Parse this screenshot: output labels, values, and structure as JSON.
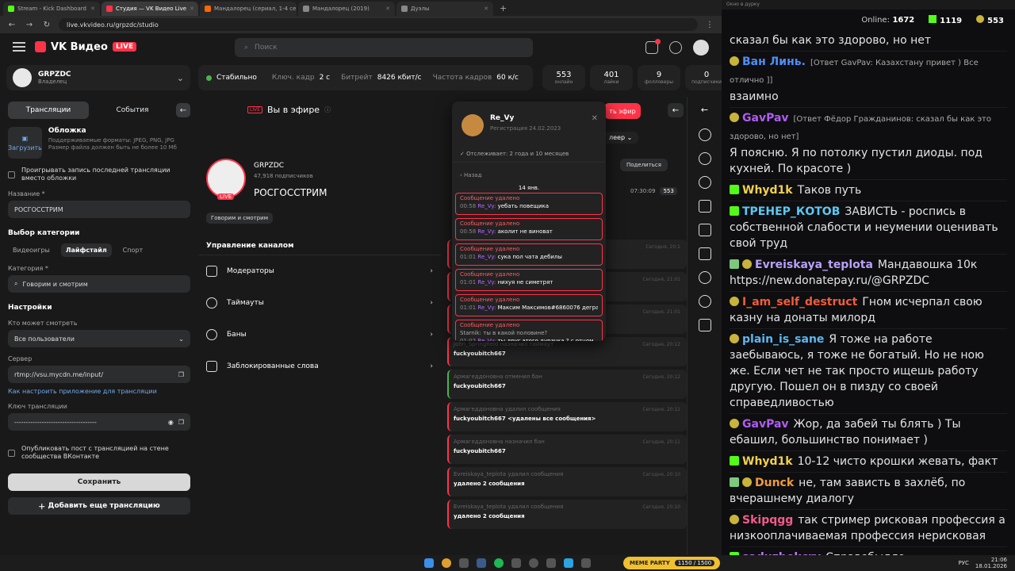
{
  "browser": {
    "tabs": [
      {
        "label": "Stream - Kick Dashboard",
        "color": "#53fc18"
      },
      {
        "label": "Студия — VK Видео Live",
        "color": "#ff3347"
      },
      {
        "label": "Мандалорец (сериал, 1-4 сезон)",
        "color": "#ff6600"
      },
      {
        "label": "Мандалорец (2019)",
        "color": "#888888"
      },
      {
        "label": "Дуэлы",
        "color": "#888888"
      }
    ],
    "url": "live.vkvideo.ru/grpzdc/studio"
  },
  "vk": {
    "logo": "VK Видео",
    "logo_live": "LIVE",
    "search_placeholder": "Поиск"
  },
  "channel": {
    "name": "GRPZDC",
    "role": "Владелец"
  },
  "sidebar": {
    "tab_streams": "Трансляции",
    "tab_events": "События",
    "cover_upload": "Загрузить",
    "cover_title": "Обложка",
    "cover_desc": "Поддерживаемые форматы: JPEG, PNG, JPG Размер файла должен быть не более 10 Мб",
    "replay_label": "Проигрывать запись последней трансляции вместо обложки",
    "title_label": "Название *",
    "title_value": "РОСГОССТРИМ",
    "category_section": "Выбор категории",
    "cat_games": "Видеоигры",
    "cat_life": "Лайфстайл",
    "cat_sport": "Спорт",
    "category_label": "Категория *",
    "category_value": "Говорим и смотрим",
    "settings": "Настройки",
    "who_label": "Кто может смотреть",
    "who_value": "Все пользователи",
    "server_label": "Сервер",
    "server_value": "rtmp://vsu.mycdn.me/input/",
    "setup_link": "Как настроить приложение для трансляции",
    "key_label": "Ключ трансляции",
    "key_value": "------------------------------------",
    "publish_label": "Опубликовать пост с трансляцией на стене сообщества ВКонтакте",
    "save": "Сохранить",
    "add": "Добавить еще трансляцию"
  },
  "stats": {
    "status": "Стабильно",
    "keyframe_label": "Ключ. кадр",
    "keyframe_value": "2 с",
    "bitrate_label": "Битрейт",
    "bitrate_value": "8426 кбит/с",
    "fps_label": "Частота кадров",
    "fps_value": "60 к/с",
    "boxes": [
      {
        "n": "553",
        "l": "онлайн"
      },
      {
        "n": "401",
        "l": "лайки"
      },
      {
        "n": "9",
        "l": "фолловеры"
      },
      {
        "n": "0",
        "l": "подписчики"
      }
    ]
  },
  "center": {
    "onair_tag": "LIVE",
    "onair": "Вы в эфире",
    "live_btn": "ть эфир",
    "player": "леер",
    "name": "GRPZDC",
    "subs": "47,918 подписчиков",
    "title": "РОСГОССТРИМ",
    "live": "LIVE",
    "tag": "Говорим и смотрим",
    "share": "Поделиться",
    "timer": "07:30:09",
    "viewers": "553"
  },
  "manage": {
    "header": "Управление каналом",
    "rows": [
      "Модераторы",
      "Таймауты",
      "Баны",
      "Заблокированные слова"
    ]
  },
  "log": [
    {
      "top": "",
      "txt": "",
      "tm": "Сегодня, 20:1",
      "kind": "red"
    },
    {
      "top": "",
      "txt": "",
      "tm": "Сегодня, 21:01",
      "kind": "red"
    },
    {
      "top": "",
      "txt": "Re_Vy",
      "tm": "Сегодня, 21:01",
      "kind": "red"
    },
    {
      "top": "John_Springfield назначил таймаут",
      "txt": "fuckyoubitch667",
      "tm": "Сегодня, 20:12",
      "kind": "red"
    },
    {
      "top": "Армагеддоновна отменил бан",
      "txt": "fuckyoubitch667",
      "tm": "Сегодня, 20:12",
      "kind": "green"
    },
    {
      "top": "Армагеддоновна удалил сообщения",
      "txt": "fuckyoubitch667 <удалены все сообщения>",
      "tm": "Сегодня, 20:11",
      "kind": "red"
    },
    {
      "top": "Армагеддоновна назначил бан",
      "txt": "fuckyoubitch667",
      "tm": "Сегодня, 20:11",
      "kind": "red"
    },
    {
      "top": "Evreiskaya_teplota удалил сообщения",
      "txt": "удалено 2 сообщения",
      "tm": "Сегодня, 20:10",
      "kind": "red"
    },
    {
      "top": "Evreiskaya_teplota удалил сообщения",
      "txt": "удалено 2 сообщения",
      "tm": "Сегодня, 20:10",
      "kind": "red"
    }
  ],
  "popup": {
    "name": "Re_Vy",
    "reg": "Регистрация 24.02.2023",
    "follow": "Отслеживает: 2 года и 10 месяцев",
    "back": "Назад",
    "date": "14 янв.",
    "deleted": "Сообщение удалено",
    "messages": [
      {
        "time": "00:58",
        "user": "Re_Vy:",
        "text": "уебать повещика"
      },
      {
        "time": "00:58",
        "user": "Re_Vy:",
        "text": "аколит не виноват"
      },
      {
        "time": "01:01",
        "user": "Re_Vy:",
        "text": "сука пол чата дебилы"
      },
      {
        "time": "01:01",
        "user": "Re_Vy:",
        "text": "нихуя не симетрят"
      },
      {
        "time": "01:01",
        "user": "Re_Vy:",
        "text": "Максим Максимов#6860076 дегра"
      },
      {
        "time": "01:02",
        "user": "Re_Vy:",
        "text": "ты друг этого дурачка ? с отцом"
      }
    ],
    "reply": "Starnik: ты в какой половине?"
  },
  "chat": {
    "titlebar": "Окно в дурку",
    "online_label": "Online:",
    "online": "1672",
    "count1": "1119",
    "count2": "553",
    "messages": [
      {
        "badges": [],
        "user": "",
        "color": "#ffffff",
        "reply": "",
        "text": "сказал бы как это здорово, но нет"
      },
      {
        "badges": [
          "face"
        ],
        "user": "Ван Линь.",
        "color": "#4f8ef7",
        "reply": "[Ответ GavPav: Казахстану привет ) Все отлично ]]",
        "text": "взаимно"
      },
      {
        "badges": [
          "face"
        ],
        "user": "GavPav",
        "color": "#b05cf2",
        "reply": "[Ответ Фёдор Граждaнинов: сказал бы как это здорово, но нет]",
        "text": "Я поясню. Я по потолку пустил диоды. под кухней. По красоте )"
      },
      {
        "badges": [
          "k"
        ],
        "user": "Whyd1k",
        "color": "#f2d14b",
        "reply": "",
        "text": "Таков путь"
      },
      {
        "badges": [
          "k"
        ],
        "user": "ТРЕНЕР_КОТОВ",
        "color": "#5cc8f2",
        "reply": "",
        "text": "ЗАВИСТЬ - роспись в собственной слабости и неумении оценивать свой труд"
      },
      {
        "badges": [
          "edit",
          "face"
        ],
        "user": "Evreiskaya_teplota",
        "color": "#b9a0f7",
        "reply": "",
        "text": "Мандавошка 10к https://new.donatepay.ru/@GRPZDC"
      },
      {
        "badges": [
          "face"
        ],
        "user": "I_am_self_destruct",
        "color": "#f25c3b",
        "reply": "",
        "text": "Гном исчерпал свою казну на донаты милорд"
      },
      {
        "badges": [
          "face"
        ],
        "user": "plain_is_sane",
        "color": "#5cb8f2",
        "reply": "",
        "text": "Я тоже на работе заебываюсь, я тоже не богатый. Но не ною же. Если чет не так просто ищешь работу другую. Пошел он в пизду со своей справедливостью"
      },
      {
        "badges": [
          "face"
        ],
        "user": "GavPav",
        "color": "#b05cf2",
        "reply": "",
        "text": "Жор, да забей ты блять ) Ты ебашил, большинство понимает )"
      },
      {
        "badges": [
          "k"
        ],
        "user": "Whyd1k",
        "color": "#f2d14b",
        "reply": "",
        "text": "10-12 чисто крошки жевать, факт"
      },
      {
        "badges": [
          "edit",
          "face"
        ],
        "user": "Dunck",
        "color": "#f29a3b",
        "reply": "",
        "text": "не, там зависть в захлёб, по вчерашнему диалогу"
      },
      {
        "badges": [
          "face"
        ],
        "user": "Skipqgg",
        "color": "#f25c8c",
        "reply": "",
        "text": "так стример рисковая профессия а низкооплачиваемая профессия нерисковая"
      },
      {
        "badges": [
          "k"
        ],
        "user": "saduzbekcry",
        "color": "#c07cf2",
        "reply": "",
        "text": "Справебыдло"
      }
    ]
  },
  "taskbar": {
    "meme": "MEME PARTY",
    "meme_count": "1150 / 1500",
    "lang": "РУС",
    "time": "21:06",
    "date": "18.01.2026"
  }
}
